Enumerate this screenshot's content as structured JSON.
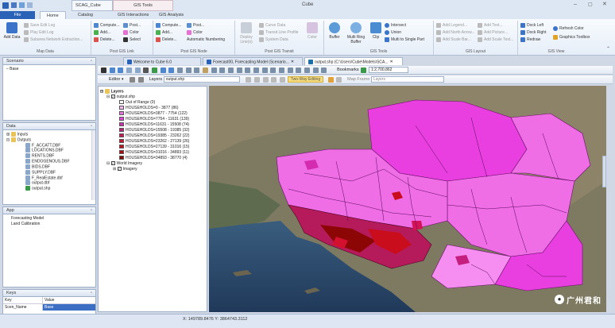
{
  "app_title": "Cube",
  "context_headers": [
    "SCAG_Cube",
    "GIS Tools"
  ],
  "tabs": [
    "File",
    "Home",
    "Catalog",
    "GIS Interactions",
    "GIS Analysis"
  ],
  "ribbon": {
    "map_data": {
      "label": "Map Data",
      "add_data": "Add Data",
      "save_edit_log": "Save Edit Log",
      "play_edit_log": "Play Edit Log",
      "subarea": "Subarea Network Extraction..."
    },
    "post_gis_link": {
      "label": "Post GIS Link",
      "compute": "Compute...",
      "post": "Post...",
      "add": "Add...",
      "color": "Color",
      "delete": "Delete...",
      "select": "Select"
    },
    "post_gis_node": {
      "label": "Post GIS Node",
      "compute": "Compute...",
      "post": "Post...",
      "add": "Add...",
      "color": "Color",
      "delete": "Delete...",
      "auto_num": "Automatic Numbering"
    },
    "post_gis_transit": {
      "label": "Post GIS Transit",
      "deploy": "Deploy Line(s)",
      "curve_data": "Curve Data",
      "transit_line_profile": "Transit Line Profile",
      "system_data": "System Data",
      "color": "Color"
    },
    "gis_tools": {
      "label": "GIS Tools",
      "buffer": "Buffer",
      "multi_ring": "Multi Ring Buffer",
      "clip": "Clip",
      "intersect": "Intersect",
      "union": "Union",
      "multi_single": "Multi to Single Part"
    },
    "gis_layout": {
      "label": "GIS Layout",
      "add_legend": "Add Legend...",
      "add_north_arrow": "Add North Arrow...",
      "add_scale_bar": "Add Scale Bar...",
      "add_text": "Add Text...",
      "add_picture": "Add Picture...",
      "add_scale_text": "Add Scale Text..."
    },
    "gis_view": {
      "label": "GIS View",
      "dock_left": "Dock Left",
      "dock_right": "Dock Right",
      "redraw": "Redraw",
      "refresh_color": "Refresh Color",
      "graphics_toolbox": "Graphics Toolbox"
    }
  },
  "scenario_panel": {
    "title": "Scenario",
    "items": [
      "Base"
    ]
  },
  "data_panel": {
    "title": "Data",
    "inputs": "Inputs",
    "outputs": "Outputs",
    "files": [
      "F_ACCATT.DBF",
      "LOCATIONS.DBF",
      "RENTS.DBF",
      "ENDOGENOUS.DBF",
      "BIDS.DBF",
      "SUPPLY.DBF",
      "F_RealEstate.dbf",
      "output.dbf",
      "output.shp"
    ]
  },
  "app_panel": {
    "title": "App",
    "items": [
      "Forecasting Model",
      "Land Calibration"
    ]
  },
  "keys_panel": {
    "title": "Keys",
    "headers": [
      "Key",
      "Value"
    ],
    "rows": [
      [
        "Scen_Name",
        "Base"
      ]
    ]
  },
  "doc_tabs": [
    "Welcome to Cube 6.0",
    "Forecast00, Forecasting Model (Scenario...",
    "output.shp (C:\\Users\\Cube\\Models\\SCA..."
  ],
  "toolbar": {
    "bookmarks": "Bookmarks",
    "scale": "1:2,700,862",
    "editor": "Editor",
    "layers_label": "Layers",
    "layer_value": "output.shp",
    "two_way": "Two-Way Editing",
    "map_frame": "Map Frame",
    "map_frame_value": "Layers"
  },
  "legend": {
    "root": "Layers",
    "layer": "output.shp",
    "classes": [
      {
        "label": "Out of Range (0)",
        "color": "#ffffff"
      },
      {
        "label": "HOUSEHOLDS=0 - 3877 (86)",
        "color": "#f7b6f2"
      },
      {
        "label": "HOUSEHOLDS=3877 - 7754 (122)",
        "color": "#ef6ee6"
      },
      {
        "label": "HOUSEHOLDS=7754 - 11631 (139)",
        "color": "#e93fe0"
      },
      {
        "label": "HOUSEHOLDS=11631 - 15508 (74)",
        "color": "#d42cb0"
      },
      {
        "label": "HOUSEHOLDS=15508 - 19385 (32)",
        "color": "#c41f7e"
      },
      {
        "label": "HOUSEHOLDS=19385 - 23262 (22)",
        "color": "#d21456"
      },
      {
        "label": "HOUSEHOLDS=23262 - 27139 (26)",
        "color": "#d4102f"
      },
      {
        "label": "HOUSEHOLDS=27139 - 31016 (15)",
        "color": "#c90d1c"
      },
      {
        "label": "HOUSEHOLDS=31016 - 34893 (11)",
        "color": "#b40a10"
      },
      {
        "label": "HOUSEHOLDS=34893 - 38770 (4)",
        "color": "#8d0606"
      }
    ],
    "imagery_group": "World Imagery",
    "imagery": "Imagery"
  },
  "status": {
    "coords": "X: 149789.8476 Y: 3864743.3112"
  },
  "watermark": "广州君和"
}
